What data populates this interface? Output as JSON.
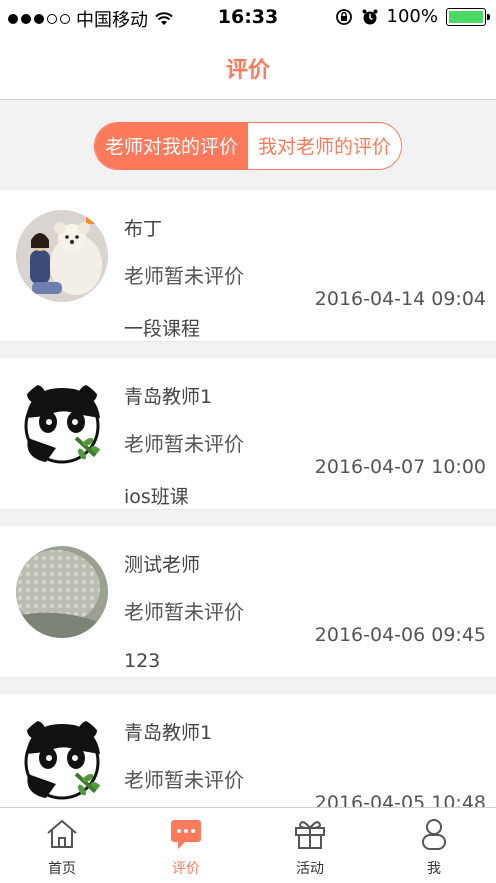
{
  "status_bar": {
    "carrier": "中国移动",
    "time": "16:33",
    "battery": "100%",
    "battery_level": 1.0
  },
  "nav": {
    "title": "评价"
  },
  "segment": {
    "tabs": [
      "老师对我的评价",
      "我对老师的评价"
    ],
    "active_index": 0
  },
  "reviews": [
    {
      "name": "布丁",
      "status": "老师暂未评价",
      "date": "2016-04-14 09:04",
      "course": "一段课程",
      "avatar": "bear-photo-avatar"
    },
    {
      "name": "青岛教师1",
      "status": "老师暂未评价",
      "date": "2016-04-07 10:00",
      "course": "ios班课",
      "avatar": "panda-avatar"
    },
    {
      "name": "测试老师",
      "status": "老师暂未评价",
      "date": "2016-04-06 09:45",
      "course": "123",
      "avatar": "lace-photo-avatar"
    },
    {
      "name": "青岛教师1",
      "status": "老师暂未评价",
      "date": "2016-04-05 10:48",
      "course": "",
      "avatar": "panda-avatar"
    }
  ],
  "tabbar": {
    "items": [
      {
        "label": "首页",
        "icon": "home-icon"
      },
      {
        "label": "评价",
        "icon": "chat-bubble-icon"
      },
      {
        "label": "活动",
        "icon": "gift-icon"
      },
      {
        "label": "我",
        "icon": "user-icon"
      }
    ],
    "active_index": 1
  },
  "colors": {
    "accent": "#ff7a5c",
    "battery": "#4cd964"
  }
}
